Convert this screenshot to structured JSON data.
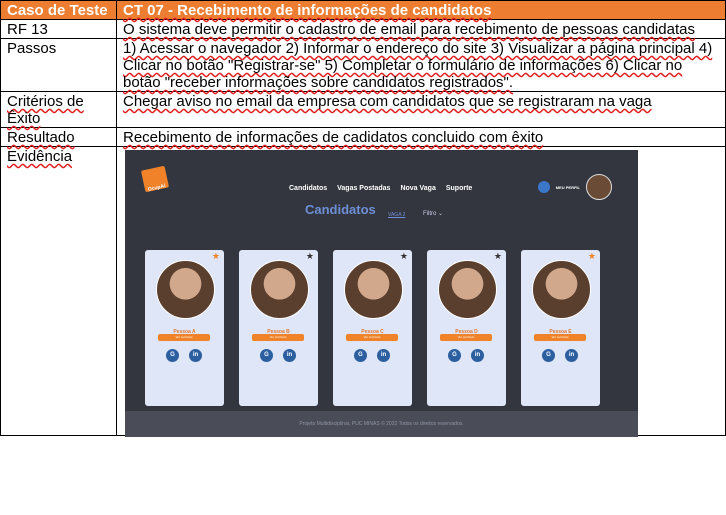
{
  "header": {
    "label": "Caso de Teste",
    "title": "CT 07 - Recebimento de informações de candidatos"
  },
  "rows": {
    "rf": {
      "label": "RF 13",
      "text": "O sistema deve permitir o cadastro de email para recebimento de pessoas candidatas"
    },
    "passos": {
      "label": "Passos",
      "text": "1) Acessar o navegador 2) Informar o endereço do site 3) Visualizar a página principal 4) Clicar no botão \"Registrar-se\" 5) Completar o formulário de informações 6) Clicar no botão \"receber informações sobre candidatos registrados\"."
    },
    "criterios": {
      "label": "Critérios de Êxito",
      "text": "Chegar aviso no email da empresa com candidatos que se registraram na vaga"
    },
    "resultado": {
      "label": "Resultado",
      "text": "Recebimento de informações de cadidatos concluido com êxito"
    },
    "evidencia": {
      "label": "Evidência"
    }
  },
  "app": {
    "logo_text": "OcupAí",
    "nav": [
      "Candidatos",
      "Vagas Postadas",
      "Nova Vaga",
      "Suporte"
    ],
    "profile_label": "MEU PERFIL",
    "title": "Candidatos",
    "vaga": "VAGA 2",
    "filtro": "Filtro ⌄",
    "cards": [
      {
        "name": "Pessoa A",
        "button": "Ver currículo",
        "star_color": "#f0832a"
      },
      {
        "name": "Pessoa B",
        "button": "Ver currículo",
        "star_color": "#333333"
      },
      {
        "name": "Pessoa C",
        "button": "Ver currículo",
        "star_color": "#333333"
      },
      {
        "name": "Pessoa D",
        "button": "Ver currículo",
        "star_color": "#333333"
      },
      {
        "name": "Pessoa E",
        "button": "Ver currículo",
        "star_color": "#f0832a"
      }
    ],
    "footer": "Projeto Multidisciplinar, PUC MINAS © 2022 Todos os direitos reservados."
  }
}
